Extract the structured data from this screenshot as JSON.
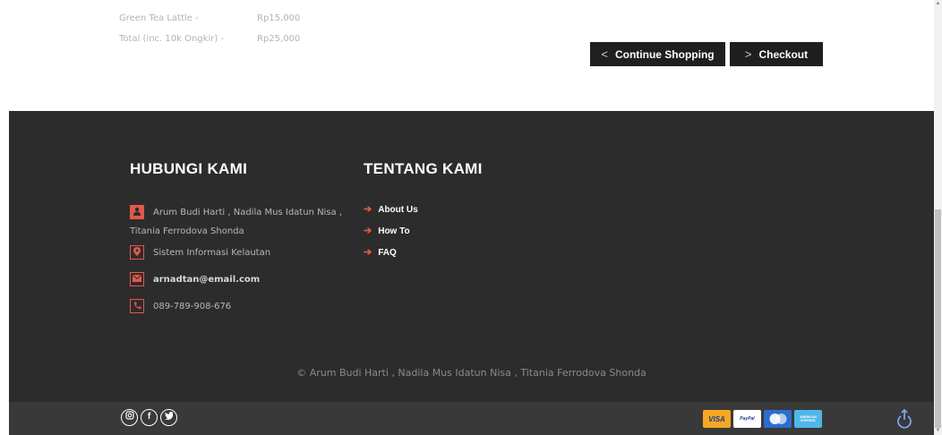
{
  "summary": {
    "rows": [
      {
        "label": "Green Tea Lattle -",
        "value": "Rp15,000"
      },
      {
        "label": "Total (inc. 10k Ongkir) -",
        "value": "Rp25,000"
      }
    ],
    "continue_label": "Continue Shopping",
    "checkout_label": "Checkout"
  },
  "footer": {
    "contact_title": "HUBUNGI KAMI",
    "contact_names_line1": "Arum Budi Harti , Nadila Mus Idatun Nisa ,",
    "contact_names_line2": "Titania Ferrodova Shonda",
    "contact_place": "Sistem Informasi Kelautan",
    "contact_email": "arnadtan@email.com",
    "contact_phone": "089-789-908-676",
    "about_title": "TENTANG KAMI",
    "links": [
      "About Us",
      "How To",
      "FAQ"
    ],
    "copyright": "© Arum Budi Harti , Nadila Mus Idatun Nisa , Titania Ferrodova Shonda"
  },
  "bottom": {
    "social": [
      "instagram-icon",
      "facebook-icon",
      "twitter-icon"
    ],
    "cards": {
      "visa": "VISA",
      "paypal": "PayPal",
      "mastercard": "MasterCard",
      "amex": "AMERICAN EXPRESS"
    }
  },
  "colors": {
    "accent": "#e2584a",
    "footer_bg": "#2d2c2c",
    "bar_bg": "#3a3939",
    "button_bg": "#1f1f1f"
  }
}
